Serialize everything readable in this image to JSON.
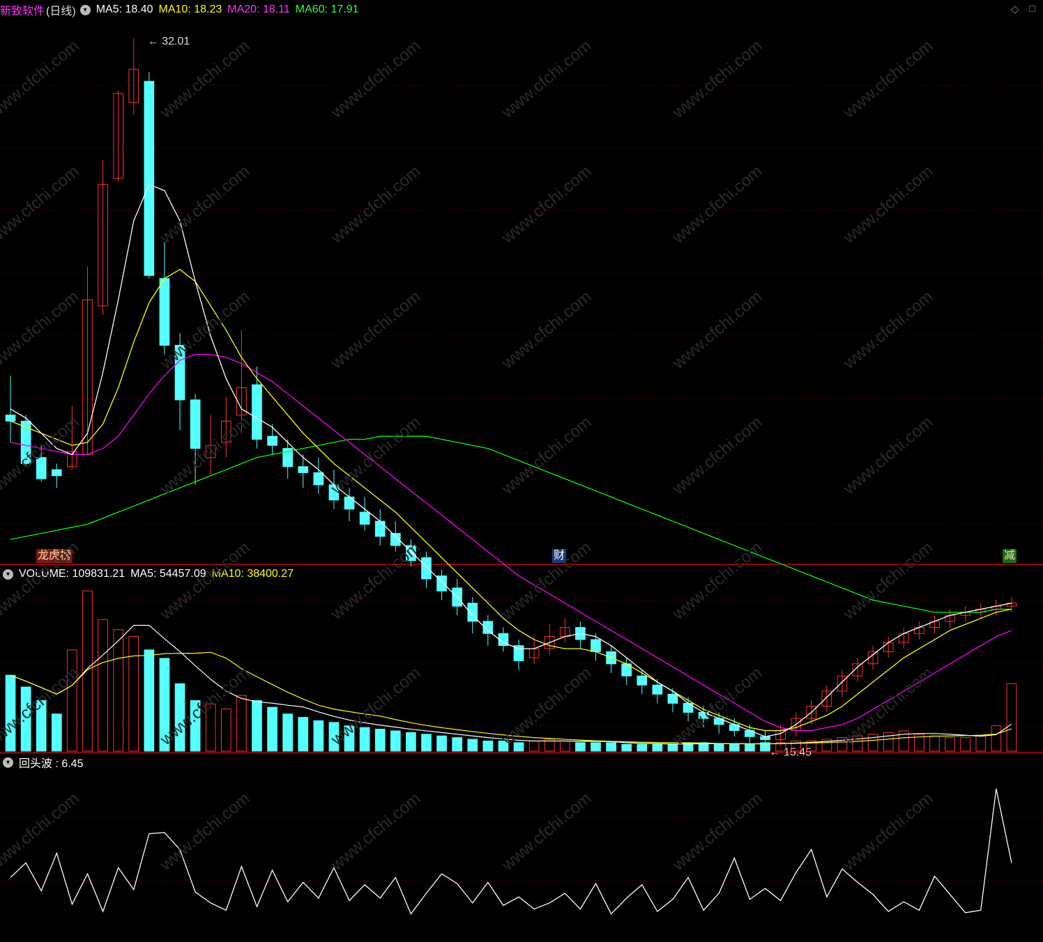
{
  "app": {
    "name": "新致软件",
    "period": "(日线)",
    "colors": {
      "up": "#ff3232",
      "down": "#54ffff",
      "bg": "#000000",
      "grid": "#5a0000",
      "ma5": "#ffffff",
      "ma10": "#ffff00",
      "ma20": "#ff00ff",
      "ma60": "#00ff00"
    }
  },
  "main_legend": {
    "ma5_label": "MA5: 18.40",
    "ma10_label": "MA10: 18.23",
    "ma20_label": "MA20: 18.11",
    "ma60_label": "MA60: 17.91"
  },
  "annotations": {
    "high": "32.01",
    "low": "15.45"
  },
  "markers": {
    "left": "龙虎榜",
    "mid": "财",
    "right": "减"
  },
  "volume_legend": {
    "volume_label": "VOLUME: 109831.21",
    "ma5_label": "MA5: 54457.09",
    "ma10_label": "MA10: 38400.27"
  },
  "indicator_legend": {
    "label": "回头波 : 6.45"
  },
  "watermark": "www.cfchi.com",
  "chart_data": {
    "type": "candlestick",
    "count": 66,
    "ylim": [
      15.0,
      32.5
    ],
    "candles": [
      [
        19.6,
        19.4,
        20.9,
        18.7
      ],
      [
        19.4,
        18.0,
        19.6,
        17.9
      ],
      [
        18.2,
        17.5,
        18.6,
        17.4
      ],
      [
        17.8,
        17.6,
        18.0,
        17.2
      ],
      [
        17.9,
        18.4,
        19.9,
        17.8
      ],
      [
        18.3,
        23.4,
        24.5,
        18.3
      ],
      [
        23.2,
        27.2,
        28.0,
        22.9
      ],
      [
        27.4,
        30.2,
        30.3,
        27.3
      ],
      [
        29.9,
        31.0,
        32.0,
        29.5
      ],
      [
        30.6,
        24.2,
        30.9,
        24.1
      ],
      [
        24.1,
        21.9,
        25.3,
        21.6
      ],
      [
        21.9,
        20.1,
        22.3,
        19.1
      ],
      [
        20.1,
        18.5,
        20.3,
        17.3
      ],
      [
        18.2,
        18.6,
        19.6,
        17.6
      ],
      [
        18.7,
        19.4,
        20.2,
        18.2
      ],
      [
        19.6,
        20.5,
        22.4,
        19.0
      ],
      [
        20.6,
        18.8,
        21.2,
        18.5
      ],
      [
        18.9,
        18.6,
        19.3,
        18.3
      ],
      [
        18.5,
        17.9,
        18.8,
        17.5
      ],
      [
        17.9,
        17.7,
        18.3,
        17.2
      ],
      [
        17.7,
        17.3,
        18.2,
        17.0
      ],
      [
        17.3,
        16.8,
        17.8,
        16.5
      ],
      [
        16.9,
        16.5,
        17.2,
        16.1
      ],
      [
        16.4,
        16.0,
        16.9,
        15.8
      ],
      [
        16.1,
        15.6,
        16.5,
        15.3
      ],
      [
        15.7,
        15.3,
        16.1,
        15.1
      ],
      [
        15.3,
        14.8,
        15.5,
        14.6
      ],
      [
        14.9,
        14.2,
        15.1,
        13.9
      ],
      [
        14.3,
        13.8,
        14.5,
        13.5
      ],
      [
        13.9,
        13.3,
        14.2,
        13.0
      ],
      [
        13.4,
        12.8,
        13.6,
        12.4
      ],
      [
        12.8,
        12.4,
        13.0,
        12.0
      ],
      [
        12.4,
        12.0,
        12.6,
        11.8
      ],
      [
        12.0,
        11.5,
        12.2,
        11.2
      ],
      [
        11.6,
        11.9,
        12.3,
        11.4
      ],
      [
        11.9,
        12.3,
        12.7,
        11.7
      ],
      [
        12.3,
        12.6,
        12.9,
        12.1
      ],
      [
        12.6,
        12.2,
        12.8,
        11.9
      ],
      [
        12.2,
        11.8,
        12.4,
        11.5
      ],
      [
        11.8,
        11.4,
        12.0,
        11.1
      ],
      [
        11.4,
        11.0,
        11.6,
        10.7
      ],
      [
        11.0,
        10.7,
        11.2,
        10.4
      ],
      [
        10.7,
        10.4,
        10.9,
        10.1
      ],
      [
        10.4,
        10.1,
        10.6,
        9.8
      ],
      [
        10.1,
        9.8,
        10.3,
        9.5
      ],
      [
        9.8,
        9.6,
        10.0,
        9.3
      ],
      [
        9.6,
        9.4,
        9.8,
        9.1
      ],
      [
        9.4,
        9.2,
        9.6,
        9.0
      ],
      [
        9.2,
        9.0,
        9.4,
        8.8
      ],
      [
        9.0,
        8.9,
        9.2,
        8.7
      ],
      [
        8.9,
        9.2,
        9.4,
        8.7
      ],
      [
        9.2,
        9.6,
        9.8,
        9.0
      ],
      [
        9.6,
        10.0,
        10.2,
        9.4
      ],
      [
        10.0,
        10.5,
        10.7,
        9.8
      ],
      [
        10.5,
        11.0,
        11.2,
        10.3
      ],
      [
        11.0,
        11.4,
        11.6,
        10.8
      ],
      [
        11.4,
        11.8,
        12.0,
        11.2
      ],
      [
        11.8,
        12.1,
        12.3,
        11.6
      ],
      [
        12.1,
        12.4,
        12.6,
        11.9
      ],
      [
        12.4,
        12.6,
        12.8,
        12.2
      ],
      [
        12.6,
        12.8,
        13.0,
        12.4
      ],
      [
        12.8,
        13.0,
        13.2,
        12.6
      ],
      [
        13.0,
        13.1,
        13.3,
        12.8
      ],
      [
        13.1,
        13.2,
        13.4,
        12.9
      ],
      [
        13.2,
        13.3,
        13.5,
        13.0
      ],
      [
        13.3,
        13.4,
        13.6,
        13.1
      ]
    ],
    "ma5": [
      19.8,
      19.5,
      19.0,
      18.5,
      18.3,
      19.0,
      21.0,
      23.4,
      26.0,
      27.2,
      27.0,
      26.0,
      24.0,
      22.2,
      20.8,
      19.8,
      19.5,
      19.2,
      18.7,
      18.2,
      17.8,
      17.3,
      16.9,
      16.5,
      16.1,
      15.6,
      15.1,
      14.6,
      14.1,
      13.6,
      13.0,
      12.5,
      12.1,
      11.9,
      11.9,
      12.1,
      12.3,
      12.4,
      12.3,
      12.0,
      11.6,
      11.2,
      10.8,
      10.5,
      10.1,
      9.8,
      9.6,
      9.4,
      9.2,
      9.0,
      9.1,
      9.4,
      9.8,
      10.3,
      10.8,
      11.3,
      11.7,
      12.1,
      12.4,
      12.6,
      12.8,
      13.0,
      13.1,
      13.2,
      13.3,
      13.4
    ],
    "ma10": [
      19.4,
      19.2,
      19.0,
      18.8,
      18.6,
      18.7,
      19.3,
      20.5,
      22.0,
      23.3,
      24.1,
      24.4,
      24.0,
      23.2,
      22.4,
      21.5,
      20.8,
      20.2,
      19.6,
      19.0,
      18.5,
      18.0,
      17.6,
      17.2,
      16.8,
      16.4,
      15.9,
      15.4,
      14.9,
      14.4,
      13.9,
      13.4,
      12.9,
      12.5,
      12.2,
      12.0,
      11.9,
      11.9,
      11.8,
      11.6,
      11.4,
      11.1,
      10.8,
      10.5,
      10.2,
      9.9,
      9.7,
      9.5,
      9.3,
      9.2,
      9.2,
      9.3,
      9.5,
      9.7,
      10.0,
      10.4,
      10.8,
      11.2,
      11.6,
      11.9,
      12.2,
      12.5,
      12.7,
      12.9,
      13.1,
      13.2
    ],
    "ma20": [
      18.7,
      18.6,
      18.5,
      18.4,
      18.3,
      18.3,
      18.5,
      18.9,
      19.6,
      20.3,
      20.9,
      21.4,
      21.6,
      21.6,
      21.5,
      21.3,
      21.0,
      20.7,
      20.3,
      19.9,
      19.5,
      19.1,
      18.7,
      18.3,
      17.9,
      17.5,
      17.1,
      16.7,
      16.3,
      15.9,
      15.5,
      15.1,
      14.7,
      14.3,
      14.0,
      13.7,
      13.4,
      13.1,
      12.8,
      12.5,
      12.2,
      11.9,
      11.6,
      11.3,
      11.0,
      10.7,
      10.4,
      10.1,
      9.8,
      9.5,
      9.3,
      9.2,
      9.2,
      9.3,
      9.4,
      9.6,
      9.9,
      10.2,
      10.5,
      10.8,
      11.1,
      11.4,
      11.7,
      12.0,
      12.3,
      12.5
    ],
    "ma60": [
      15.5,
      15.6,
      15.7,
      15.8,
      15.9,
      16.0,
      16.2,
      16.4,
      16.6,
      16.8,
      17.0,
      17.2,
      17.4,
      17.6,
      17.8,
      18.0,
      18.2,
      18.3,
      18.4,
      18.5,
      18.6,
      18.7,
      18.8,
      18.8,
      18.9,
      18.9,
      18.9,
      18.9,
      18.8,
      18.7,
      18.6,
      18.5,
      18.3,
      18.1,
      17.9,
      17.7,
      17.5,
      17.3,
      17.1,
      16.9,
      16.7,
      16.5,
      16.3,
      16.1,
      15.9,
      15.7,
      15.5,
      15.3,
      15.1,
      14.9,
      14.7,
      14.5,
      14.3,
      14.1,
      13.9,
      13.7,
      13.5,
      13.4,
      13.3,
      13.2,
      13.1,
      13.1,
      13.1,
      13.1,
      13.2,
      13.2
    ],
    "volume": [
      45,
      38,
      30,
      22,
      60,
      95,
      78,
      72,
      68,
      60,
      55,
      40,
      30,
      28,
      25,
      33,
      30,
      26,
      22,
      20,
      18,
      17,
      15,
      14,
      13,
      12,
      11,
      10,
      9,
      8,
      7,
      6,
      6,
      5,
      6,
      7,
      6,
      5,
      5,
      5,
      4,
      4,
      4,
      4,
      5,
      5,
      4,
      4,
      4,
      5,
      5,
      6,
      6,
      7,
      8,
      9,
      10,
      11,
      12,
      10,
      9,
      8,
      8,
      9,
      15,
      40
    ],
    "volume_ylim": [
      0,
      100
    ],
    "indicator": [
      5.2,
      6.4,
      4.1,
      7.2,
      3.0,
      5.5,
      2.4,
      6.0,
      4.2,
      8.8,
      8.9,
      7.5,
      4.0,
      3.1,
      2.5,
      6.1,
      2.8,
      5.8,
      3.2,
      4.8,
      3.5,
      6.0,
      3.3,
      4.6,
      3.5,
      5.2,
      2.2,
      3.9,
      5.5,
      4.7,
      3.1,
      4.8,
      2.9,
      3.6,
      2.6,
      3.1,
      3.9,
      2.6,
      4.7,
      2.2,
      3.5,
      4.6,
      2.4,
      3.4,
      5.2,
      2.5,
      3.9,
      6.8,
      3.4,
      4.3,
      3.3,
      5.6,
      7.5,
      3.6,
      5.9,
      4.8,
      3.8,
      2.4,
      3.2,
      2.5,
      5.3,
      3.8,
      2.3,
      2.5,
      12.5,
      6.4
    ],
    "indicator_ylim": [
      0,
      14
    ]
  }
}
